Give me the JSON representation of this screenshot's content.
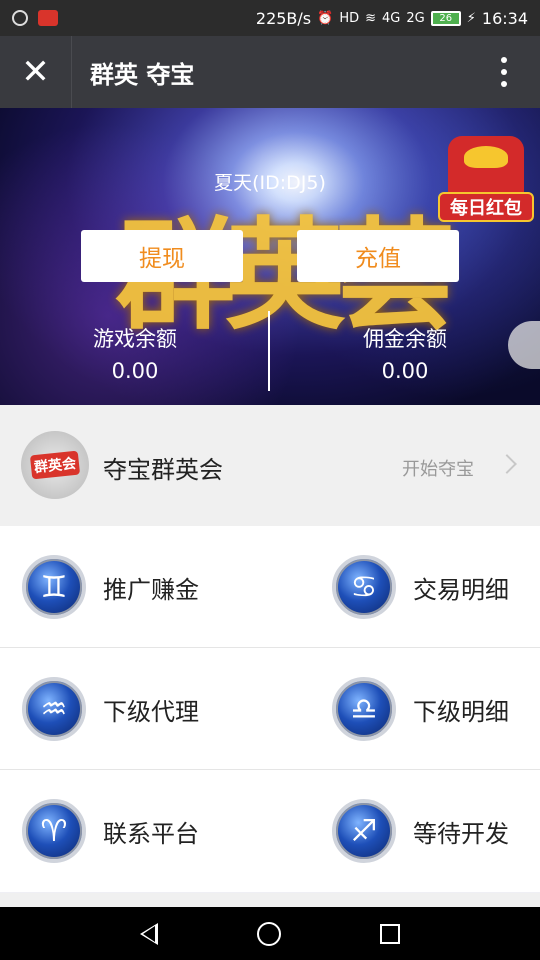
{
  "status_bar": {
    "speed": "225B/s",
    "battery": "26",
    "time": "16:34",
    "network_1": "4G",
    "network_2": "2G",
    "hd": "HD"
  },
  "title_bar": {
    "title": "群英 夺宝",
    "close_icon": "close-icon",
    "more_icon": "more-vertical-icon"
  },
  "banner": {
    "user_name": "夏天(ID:DJ5)",
    "art_text": "群英荟",
    "withdraw_label": "提现",
    "recharge_label": "充值",
    "game_balance_label": "游戏余额",
    "game_balance_value": "0.00",
    "commission_balance_label": "佣金余额",
    "commission_balance_value": "0.00",
    "red_packet_label": "每日红包"
  },
  "entry": {
    "logo_text": "群英会",
    "title": "夺宝群英会",
    "action": "开始夺宝"
  },
  "grid": {
    "items": [
      {
        "label": "推广赚金",
        "icon": "gemini-icon",
        "glyph": "♊"
      },
      {
        "label": "交易明细",
        "icon": "cancer-icon",
        "glyph": "♋"
      },
      {
        "label": "下级代理",
        "icon": "aquarius-icon",
        "glyph": "♒"
      },
      {
        "label": "下级明细",
        "icon": "libra-icon",
        "glyph": "♎"
      },
      {
        "label": "联系平台",
        "icon": "aries-icon",
        "glyph": "♈"
      },
      {
        "label": "等待开发",
        "icon": "sagittarius-icon",
        "glyph": "♐"
      }
    ]
  },
  "colors": {
    "accent": "#f08c1e",
    "titlebar": "#393a3f"
  }
}
